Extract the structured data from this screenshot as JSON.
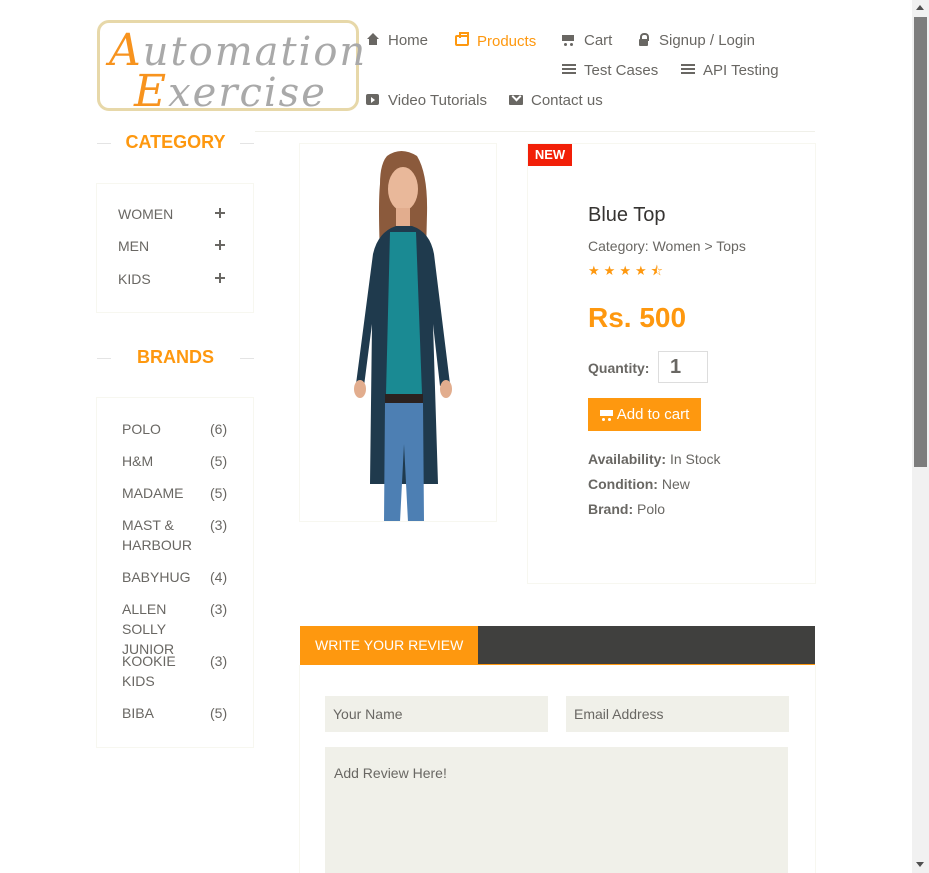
{
  "logo": {
    "text_line1": "Automation",
    "text_line2": "Exercise"
  },
  "nav": {
    "home": "Home",
    "products": "Products",
    "cart": "Cart",
    "signup_login": "Signup / Login",
    "test_cases": "Test Cases",
    "api_testing": "API Testing",
    "video_tutorials": "Video Tutorials",
    "contact_us": "Contact us",
    "active": "Products"
  },
  "sidebar": {
    "category_title": "CATEGORY",
    "categories": [
      "WOMEN",
      "MEN",
      "KIDS"
    ],
    "brands_title": "BRANDS",
    "brands": [
      {
        "name": "POLO",
        "count": "(6)"
      },
      {
        "name": "H&M",
        "count": "(5)"
      },
      {
        "name": "MADAME",
        "count": "(5)"
      },
      {
        "name": "MAST & HARBOUR",
        "count": "(3)"
      },
      {
        "name": "BABYHUG",
        "count": "(4)"
      },
      {
        "name": "ALLEN SOLLY JUNIOR",
        "count": "(3)"
      },
      {
        "name": "KOOKIE KIDS",
        "count": "(3)"
      },
      {
        "name": "BIBA",
        "count": "(5)"
      }
    ]
  },
  "product": {
    "badge": "NEW",
    "name": "Blue Top",
    "category": "Category: Women > Tops",
    "rating": 4.5,
    "price": "Rs. 500",
    "quantity_label": "Quantity:",
    "quantity_value": "1",
    "add_to_cart": "Add to cart",
    "availability_label": "Availability:",
    "availability_value": "In Stock",
    "condition_label": "Condition:",
    "condition_value": "New",
    "brand_label": "Brand:",
    "brand_value": "Polo"
  },
  "review": {
    "tab_label": "WRITE YOUR REVIEW",
    "name_placeholder": "Your Name",
    "email_placeholder": "Email Address",
    "review_placeholder": "Add Review Here!"
  },
  "colors": {
    "accent": "#fe980f",
    "badge": "#f21f08",
    "dark": "#40403e"
  }
}
